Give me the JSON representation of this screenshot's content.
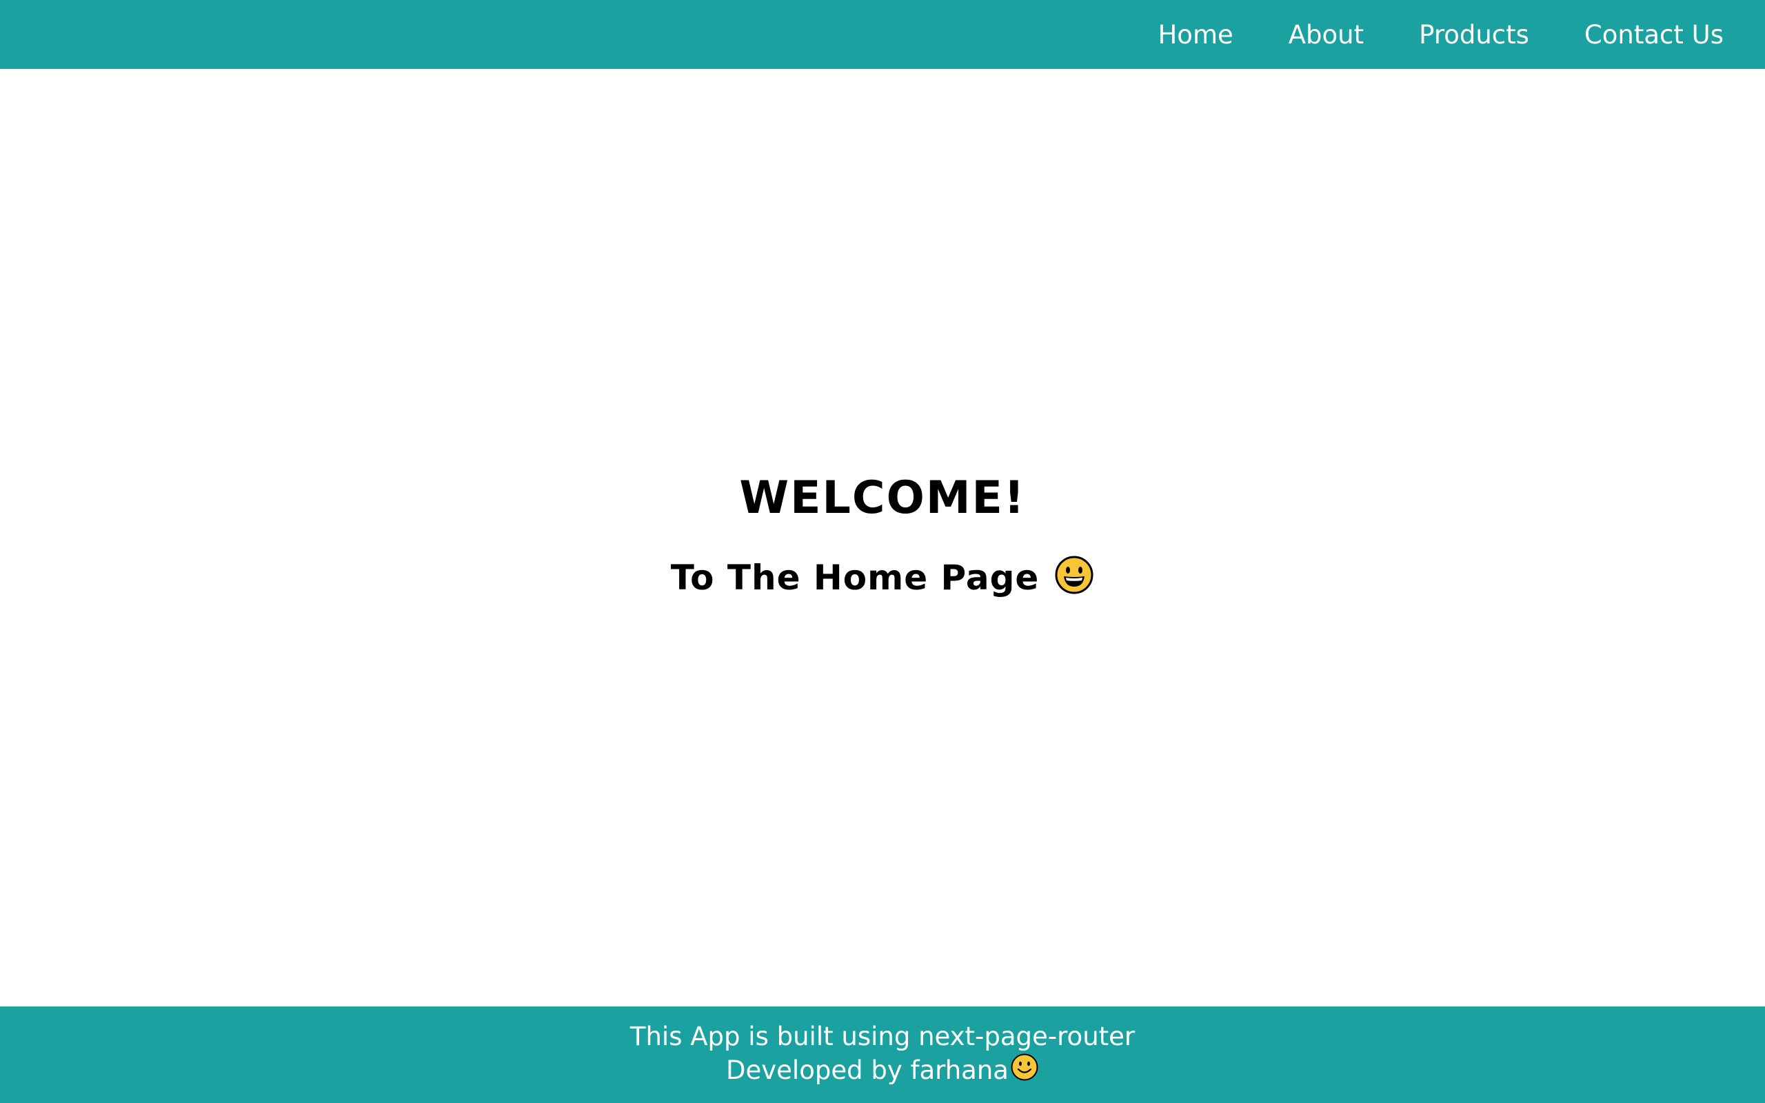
{
  "nav": {
    "items": [
      {
        "label": "Home"
      },
      {
        "label": "About"
      },
      {
        "label": "Products"
      },
      {
        "label": "Contact Us"
      }
    ]
  },
  "main": {
    "heading": "WELCOME!",
    "subheading": "To The Home Page",
    "subheading_icon": "grinning-face-icon"
  },
  "footer": {
    "line1": "This App is built using next-page-router",
    "line2": "Developed by farhana",
    "line2_icon": "smiling-face-icon"
  },
  "colors": {
    "brand": "#1ca1a1",
    "emoji_fill": "#f7c536"
  }
}
